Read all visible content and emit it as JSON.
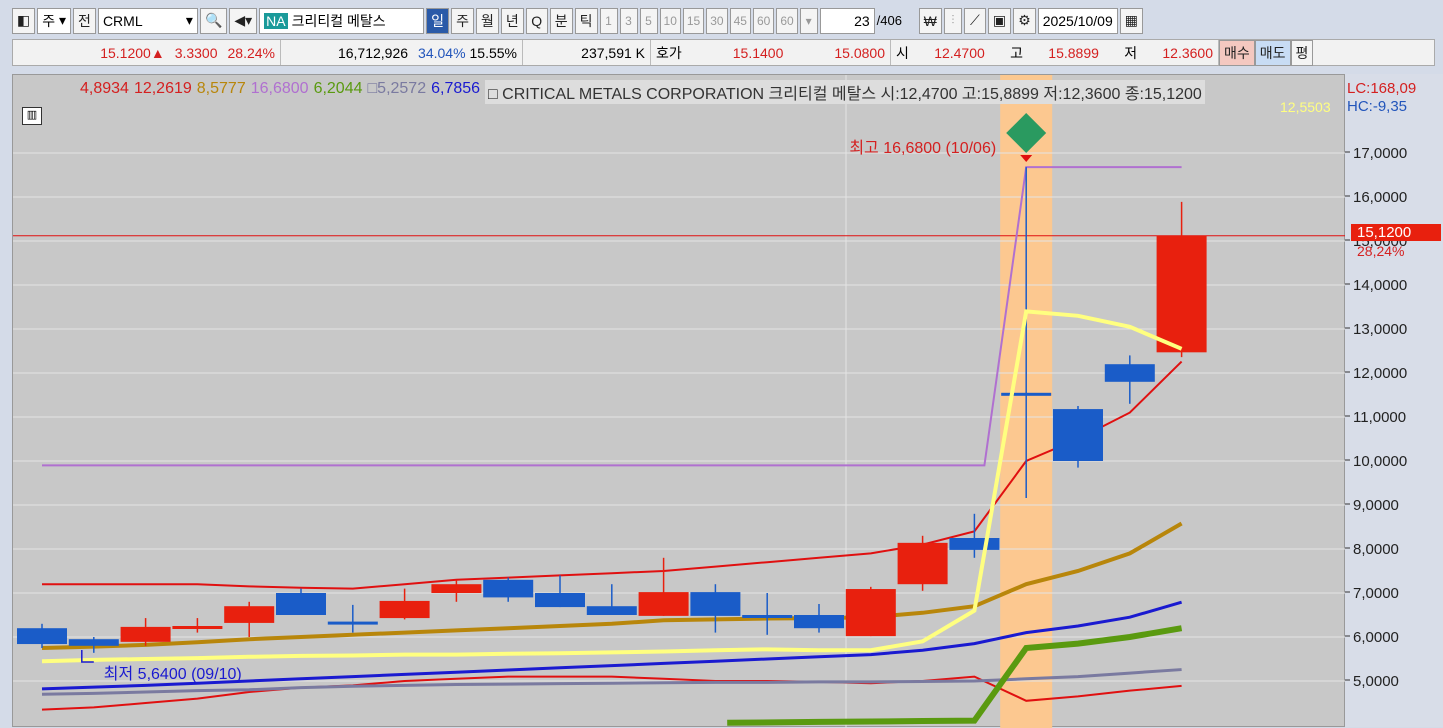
{
  "toolbar": {
    "market": "주",
    "prev": "전",
    "symbol": "CRML",
    "na": "NA",
    "name": "크리티컬 메탈스",
    "periods": [
      "일",
      "주",
      "월",
      "년",
      "Q",
      "분",
      "틱"
    ],
    "intervals": [
      "1",
      "3",
      "5",
      "10",
      "15",
      "30",
      "45",
      "60",
      "60"
    ],
    "page": "23",
    "total": "/406",
    "date": "2025/10/09"
  },
  "quote": {
    "price": "15.1200▲",
    "change": "3.3300",
    "rate": "28.24%",
    "volume": "16,712,926",
    "vol_rate": "34.04%",
    "turnover": "15.55%",
    "amount": "237,591 K",
    "hoga_label": "호가",
    "ask": "15.1400",
    "bid": "15.0800",
    "open_label": "시",
    "open": "12.4700",
    "high_label": "고",
    "high": "15.8899",
    "low_label": "저",
    "low": "12.3600",
    "buy": "매수",
    "sell": "매도",
    "avg": "평"
  },
  "legend": {
    "values": [
      {
        "v": "4,8934",
        "c": "#d42020"
      },
      {
        "v": "12,2619",
        "c": "#d42020"
      },
      {
        "v": "8,5777",
        "c": "#b8860b"
      },
      {
        "v": "16,6800",
        "c": "#b070d0"
      },
      {
        "v": "6,2044",
        "c": "#5a9a10"
      },
      {
        "v": "□5,2572",
        "c": "#7a7aa0"
      },
      {
        "v": "6,7856",
        "c": "#1a1ad0"
      }
    ],
    "title": "□ CRITICAL METALS CORPORATION  크리티컬 메탈스 시:12,4700 고:15,8899 저:12,3600 종:15,1200",
    "lc": "LC:168,09",
    "hc": "HC:-9,35",
    "yellow_val": "12,5503"
  },
  "annotations": {
    "high": "최고 16,6800 (10/06)",
    "low": "최저 5,6400 (09/10)"
  },
  "current": {
    "price": "15,1200",
    "rate": "28,24%"
  },
  "colors": {
    "up": "#e8200e",
    "down": "#1a5cc8"
  },
  "chart_data": {
    "type": "candlestick",
    "ylim": [
      4,
      18
    ],
    "yticks": [
      "5,0000",
      "6,0000",
      "7,0000",
      "8,0000",
      "9,0000",
      "10,0000",
      "11,0000",
      "12,0000",
      "13,0000",
      "14,0000",
      "15,0000",
      "16,0000",
      "17,0000"
    ],
    "candles": [
      [
        6.2,
        6.3,
        5.75,
        5.84
      ],
      [
        5.95,
        6.0,
        5.64,
        5.8
      ],
      [
        5.89,
        6.43,
        5.8,
        6.23
      ],
      [
        6.2,
        6.43,
        6.1,
        6.25
      ],
      [
        6.32,
        6.8,
        6.0,
        6.7
      ],
      [
        7.0,
        7.1,
        6.5,
        6.5
      ],
      [
        6.35,
        6.73,
        6.1,
        6.3
      ],
      [
        6.43,
        7.1,
        6.4,
        6.82
      ],
      [
        7.0,
        7.3,
        6.8,
        7.2
      ],
      [
        7.3,
        7.35,
        6.8,
        6.9
      ],
      [
        7.0,
        7.4,
        6.68,
        6.68
      ],
      [
        6.7,
        7.2,
        6.5,
        6.5
      ],
      [
        6.48,
        7.8,
        6.48,
        7.02
      ],
      [
        7.02,
        7.2,
        6.1,
        6.48
      ],
      [
        6.5,
        7.0,
        6.05,
        6.45
      ],
      [
        6.5,
        6.75,
        6.1,
        6.2
      ],
      [
        6.02,
        7.14,
        6.02,
        7.09
      ],
      [
        7.2,
        8.3,
        7.05,
        8.14
      ],
      [
        8.25,
        8.8,
        7.8,
        7.98
      ],
      [
        11.55,
        16.68,
        9.16,
        11.5
      ],
      [
        11.18,
        11.25,
        9.85,
        10.0
      ],
      [
        12.2,
        12.4,
        11.3,
        11.8
      ],
      [
        12.47,
        15.89,
        12.36,
        15.12
      ]
    ],
    "lines": [
      {
        "name": "upper-band",
        "color": "#e01010",
        "w": 2,
        "values": [
          7.2,
          7.2,
          7.2,
          7.2,
          7.15,
          7.12,
          7.1,
          7.2,
          7.3,
          7.35,
          7.4,
          7.45,
          7.5,
          7.6,
          7.7,
          7.8,
          7.9,
          8.1,
          8.4,
          10.0,
          10.5,
          11.1,
          12.26
        ]
      },
      {
        "name": "lower-band",
        "color": "#e01010",
        "w": 2,
        "values": [
          4.35,
          4.4,
          4.5,
          4.6,
          4.75,
          4.85,
          4.9,
          5.0,
          5.05,
          5.1,
          5.1,
          5.1,
          5.05,
          5.0,
          5.0,
          4.98,
          4.95,
          5.0,
          5.1,
          4.55,
          4.65,
          4.78,
          4.89
        ]
      },
      {
        "name": "purple-line",
        "color": "#b070d0",
        "w": 2,
        "values": [
          9.9,
          9.9,
          9.9,
          9.9,
          9.9,
          9.9,
          9.9,
          9.9,
          9.9,
          9.9,
          9.9,
          9.9,
          9.9,
          9.9,
          9.9,
          9.9,
          9.9,
          9.9,
          9.9,
          16.68,
          16.68,
          16.68,
          16.68
        ]
      },
      {
        "name": "gray-line",
        "color": "#7a7aa0",
        "w": 3,
        "values": [
          4.7,
          4.72,
          4.75,
          4.78,
          4.8,
          4.85,
          4.88,
          4.9,
          4.92,
          4.93,
          4.94,
          4.95,
          4.96,
          4.97,
          4.97,
          4.98,
          4.98,
          4.99,
          5.0,
          5.05,
          5.1,
          5.18,
          5.26
        ]
      },
      {
        "name": "blue-line",
        "color": "#1a1ad0",
        "w": 3,
        "values": [
          4.82,
          4.86,
          4.9,
          4.95,
          5.0,
          5.05,
          5.1,
          5.15,
          5.2,
          5.25,
          5.3,
          5.35,
          5.4,
          5.45,
          5.5,
          5.55,
          5.6,
          5.7,
          5.85,
          6.1,
          6.25,
          6.45,
          6.79
        ]
      },
      {
        "name": "gold-line",
        "color": "#b8860b",
        "w": 4,
        "values": [
          5.75,
          5.78,
          5.82,
          5.88,
          5.95,
          6.0,
          6.05,
          6.1,
          6.15,
          6.2,
          6.25,
          6.3,
          6.38,
          6.4,
          6.42,
          6.43,
          6.45,
          6.55,
          6.7,
          7.2,
          7.5,
          7.9,
          8.58
        ]
      },
      {
        "name": "green-line",
        "color": "#5a9a10",
        "w": 6,
        "values": [
          null,
          null,
          null,
          null,
          null,
          null,
          null,
          null,
          null,
          null,
          null,
          null,
          null,
          null,
          4.05,
          4.07,
          4.08,
          4.09,
          4.1,
          5.75,
          5.85,
          6.0,
          6.2
        ]
      },
      {
        "name": "yellow-line",
        "color": "#ffff80",
        "w": 4,
        "values": [
          5.45,
          5.48,
          5.5,
          5.52,
          5.55,
          5.57,
          5.58,
          5.6,
          5.6,
          5.62,
          5.63,
          5.65,
          5.67,
          5.7,
          5.72,
          5.7,
          5.7,
          5.9,
          6.6,
          13.4,
          13.3,
          13.05,
          12.55
        ]
      }
    ]
  }
}
